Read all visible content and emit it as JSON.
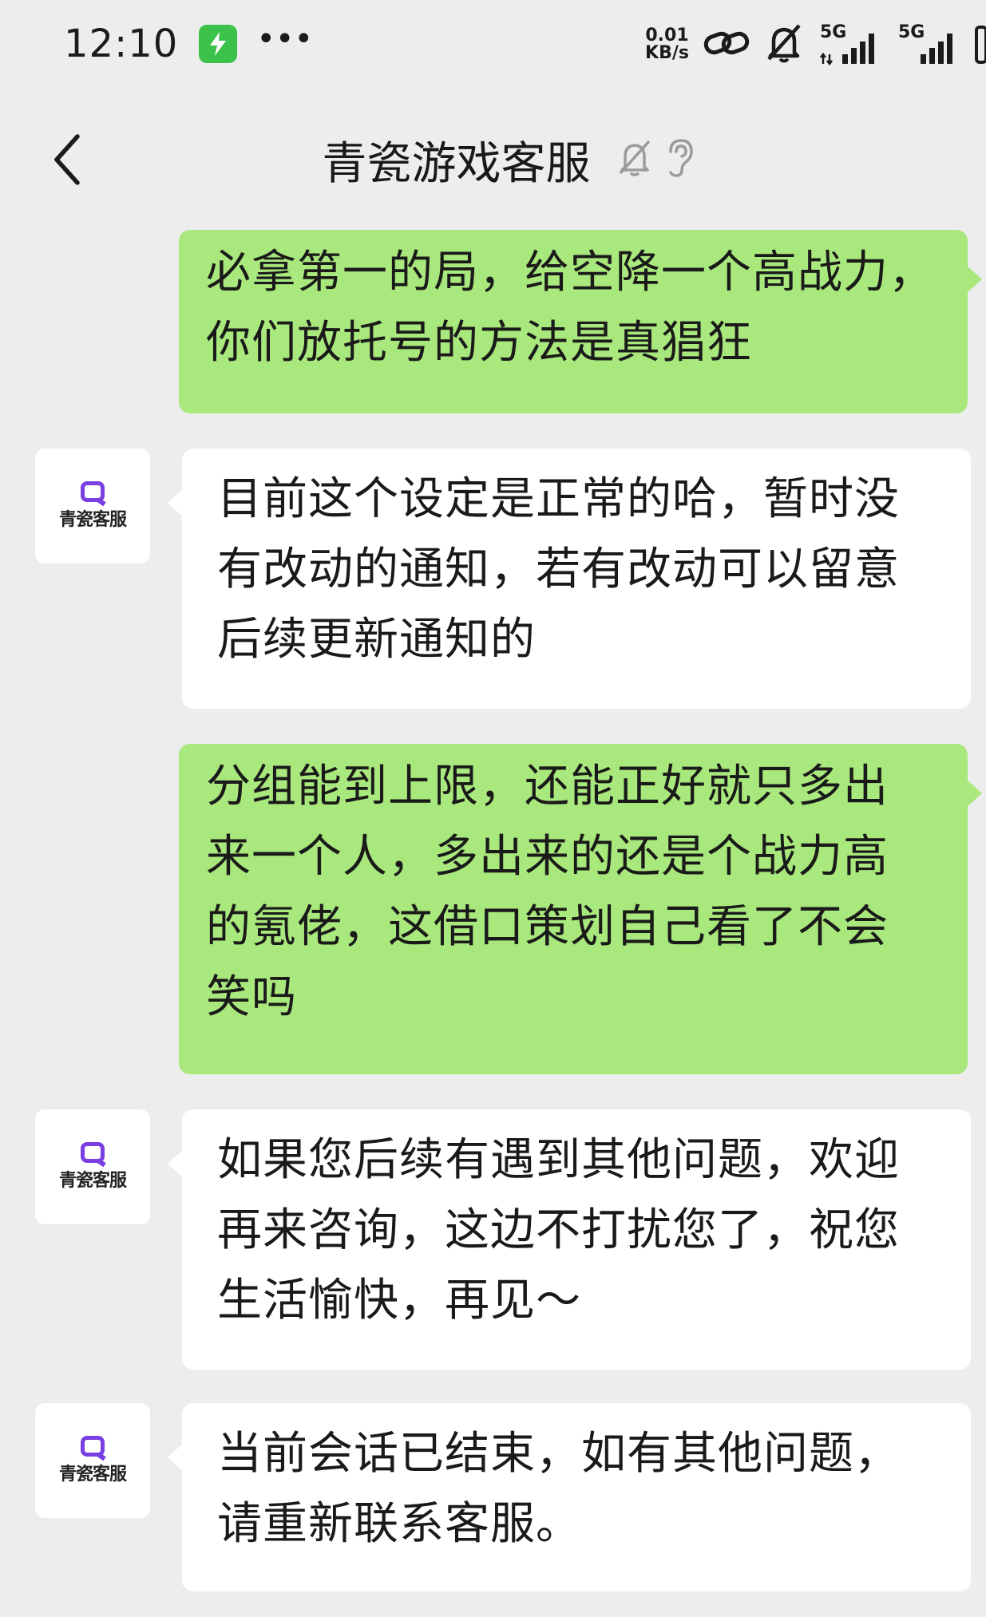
{
  "status_bar": {
    "time": "12:10",
    "net_speed_value": "0.01",
    "net_speed_unit": "KB/s",
    "signal_1": "5G",
    "signal_2": "5G",
    "icons": [
      "bolt-icon",
      "more-dots-icon",
      "link-icon",
      "mute-bell-icon",
      "signal-icon"
    ]
  },
  "header": {
    "title": "青瓷游戏客服",
    "icons": [
      "back-icon",
      "mute-bell-icon",
      "ear-icon"
    ]
  },
  "avatar": {
    "label": "青瓷客服"
  },
  "messages": [
    {
      "sender": "me",
      "lines": [
        "必拿第一的局，给空降一个高战力，",
        "你们放托号的方法是真猖狂"
      ]
    },
    {
      "sender": "service",
      "lines": [
        "目前这个设定是正常的哈，暂时没",
        "有改动的通知，若有改动可以留意",
        "后续更新通知的"
      ]
    },
    {
      "sender": "me",
      "lines": [
        "分组能到上限，还能正好就只多出",
        "来一个人，多出来的还是个战力高",
        "的氪佬，这借口策划自己看了不会",
        "笑吗"
      ]
    },
    {
      "sender": "service",
      "lines": [
        "如果您后续有遇到其他问题，欢迎",
        "再来咨询，这边不打扰您了，祝您",
        "生活愉快，再见～"
      ]
    },
    {
      "sender": "service",
      "lines": [
        "当前会话已结束，如有其他问题，",
        "请重新联系客服。"
      ]
    }
  ],
  "colors": {
    "background": "#ededed",
    "my_bubble": "#a9e87c",
    "their_bubble": "#ffffff",
    "brand_purple": "#7a3fe0",
    "battery_green": "#3cc24a"
  }
}
